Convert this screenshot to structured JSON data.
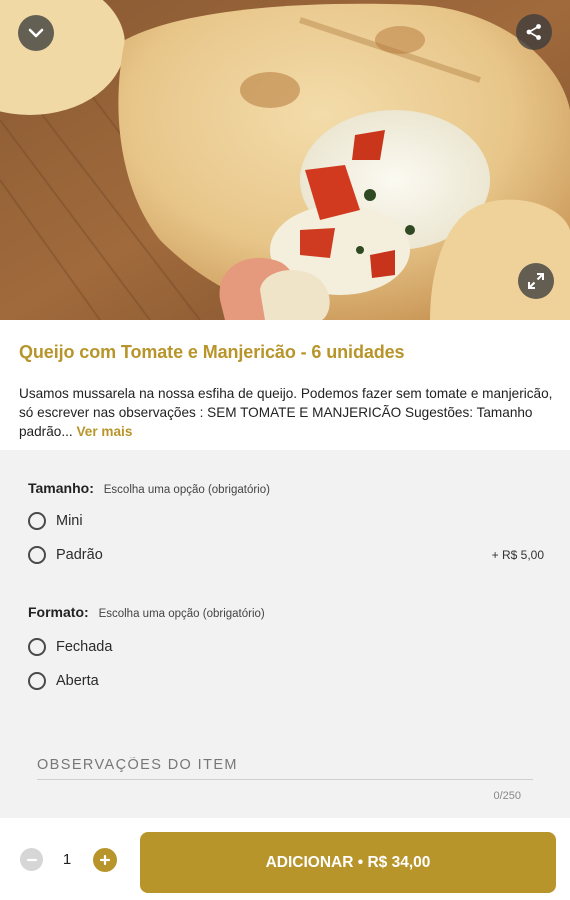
{
  "colors": {
    "accent": "#b8952a",
    "options_bg": "#f2f2f2",
    "icon_button_bg": "#3c3c3c"
  },
  "hero": {
    "image_subject": "baked esfiha filled with melted mozzarella, tomato pieces and basil on a wooden board",
    "collapse_icon": "chevron-down-icon",
    "share_icon": "share-icon",
    "expand_icon": "expand-icon"
  },
  "product": {
    "title": "Queijo com Tomate e Manjericão - 6 unidades",
    "description": "Usamos mussarela na nossa esfiha de queijo. Podemos fazer sem tomate e manjericão, só escrever nas observações : SEM TOMATE E MANJERICÃO Sugestões: Tamanho padrão...",
    "see_more": "Ver mais"
  },
  "option_groups": [
    {
      "name": "Tamanho:",
      "hint": "Escolha uma opção (obrigatório)",
      "options": [
        {
          "label": "Mini",
          "price": ""
        },
        {
          "label": "Padrão",
          "price": "+ R$ 5,00"
        }
      ]
    },
    {
      "name": "Formato:",
      "hint": "Escolha uma opção (obrigatório)",
      "options": [
        {
          "label": "Fechada",
          "price": ""
        },
        {
          "label": "Aberta",
          "price": ""
        }
      ]
    }
  ],
  "notes": {
    "placeholder": "OBSERVAÇÕES DO ITEM",
    "counter": "0/250"
  },
  "footer": {
    "quantity": "1",
    "add_button": "ADICIONAR • R$ 34,00"
  }
}
